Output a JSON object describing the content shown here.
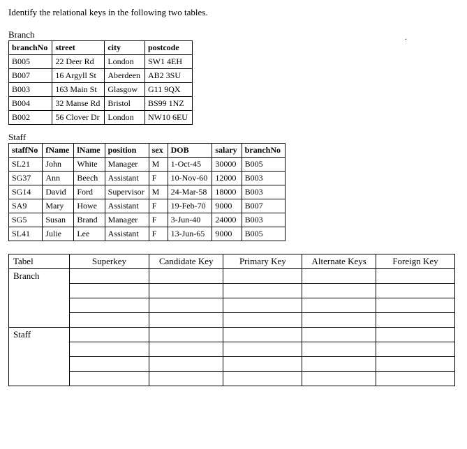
{
  "instruction": "Identify the relational keys in the following two tables.",
  "branch": {
    "label": "Branch",
    "headers": [
      "branchNo",
      "street",
      "city",
      "postcode"
    ],
    "rows": [
      {
        "branchNo": "B005",
        "street": "22 Deer Rd",
        "city": "London",
        "postcode": "SW1 4EH"
      },
      {
        "branchNo": "B007",
        "street": "16 Argyll St",
        "city": "Aberdeen",
        "postcode": "AB2 3SU"
      },
      {
        "branchNo": "B003",
        "street": "163 Main St",
        "city": "Glasgow",
        "postcode": "G11 9QX"
      },
      {
        "branchNo": "B004",
        "street": "32 Manse Rd",
        "city": "Bristol",
        "postcode": "BS99 1NZ"
      },
      {
        "branchNo": "B002",
        "street": "56 Clover Dr",
        "city": "London",
        "postcode": "NW10 6EU"
      }
    ]
  },
  "staff": {
    "label": "Staff",
    "headers": [
      "staffNo",
      "fName",
      "lName",
      "position",
      "sex",
      "DOB",
      "salary",
      "branchNo"
    ],
    "rows": [
      {
        "staffNo": "SL21",
        "fName": "John",
        "lName": "White",
        "position": "Manager",
        "sex": "M",
        "DOB": "1-Oct-45",
        "salary": "30000",
        "branchNo": "B005"
      },
      {
        "staffNo": "SG37",
        "fName": "Ann",
        "lName": "Beech",
        "position": "Assistant",
        "sex": "F",
        "DOB": "10-Nov-60",
        "salary": "12000",
        "branchNo": "B003"
      },
      {
        "staffNo": "SG14",
        "fName": "David",
        "lName": "Ford",
        "position": "Supervisor",
        "sex": "M",
        "DOB": "24-Mar-58",
        "salary": "18000",
        "branchNo": "B003"
      },
      {
        "staffNo": "SA9",
        "fName": "Mary",
        "lName": "Howe",
        "position": "Assistant",
        "sex": "F",
        "DOB": "19-Feb-70",
        "salary": "9000",
        "branchNo": "B007"
      },
      {
        "staffNo": "SG5",
        "fName": "Susan",
        "lName": "Brand",
        "position": "Manager",
        "sex": "F",
        "DOB": "3-Jun-40",
        "salary": "24000",
        "branchNo": "B003"
      },
      {
        "staffNo": "SL41",
        "fName": "Julie",
        "lName": "Lee",
        "position": "Assistant",
        "sex": "F",
        "DOB": "13-Jun-65",
        "salary": "9000",
        "branchNo": "B005"
      }
    ]
  },
  "answer": {
    "headers": [
      "Tabel",
      "Superkey",
      "Candidate Key",
      "Primary Key",
      "Alternate Keys",
      "Foreign Key"
    ],
    "row_labels": [
      "Branch",
      "Staff"
    ],
    "sub_rows_per_label": 4
  },
  "dot": "."
}
